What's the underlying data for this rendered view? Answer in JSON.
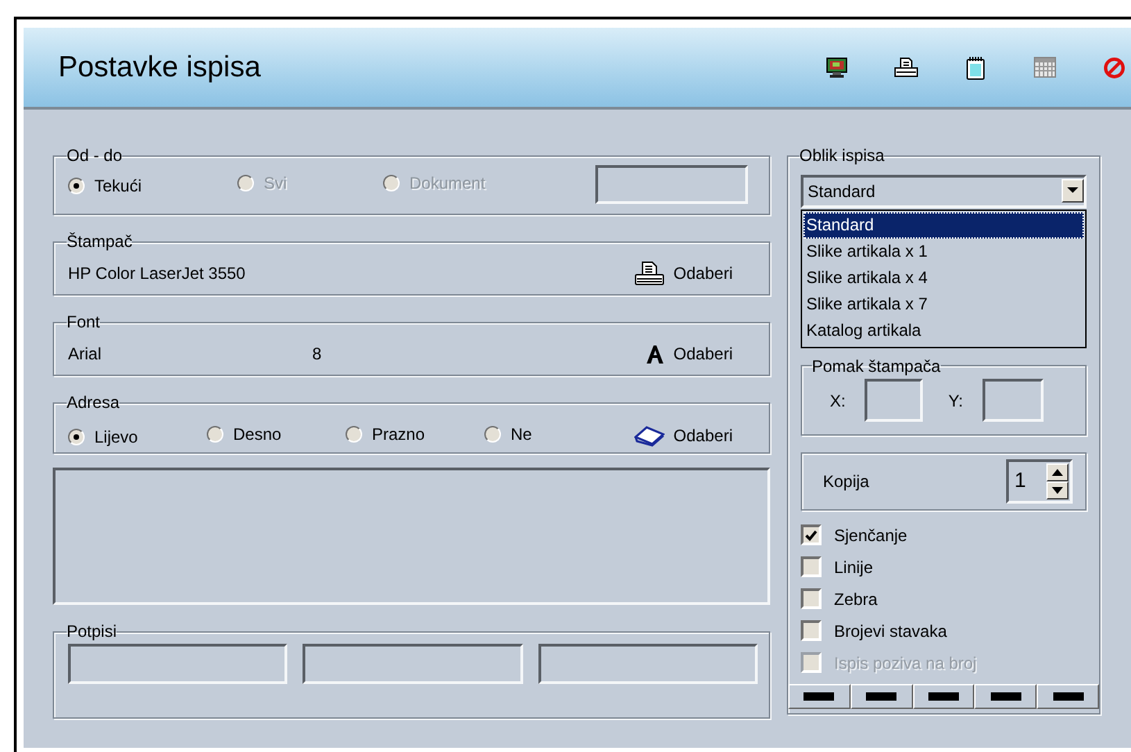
{
  "window": {
    "title": "Postavke ispisa"
  },
  "toolbar": [
    {
      "kind": "monitor"
    },
    {
      "kind": "printer"
    },
    {
      "kind": "notepad"
    },
    {
      "kind": "calendar"
    },
    {
      "kind": "cancel"
    }
  ],
  "range": {
    "legend": "Od - do",
    "options": [
      {
        "label": "Tekući",
        "selected": true,
        "disabled": false
      },
      {
        "label": "Svi",
        "selected": false,
        "disabled": true
      },
      {
        "label": "Dokument",
        "selected": false,
        "disabled": true
      }
    ]
  },
  "printer": {
    "legend": "Štampač",
    "name": "HP Color LaserJet 3550",
    "button": "Odaberi"
  },
  "font": {
    "legend": "Font",
    "name": "Arial",
    "size": "8",
    "button": "Odaberi"
  },
  "address": {
    "legend": "Adresa",
    "options": [
      {
        "label": "Lijevo",
        "selected": true
      },
      {
        "label": "Desno",
        "selected": false
      },
      {
        "label": "Prazno",
        "selected": false
      },
      {
        "label": "Ne",
        "selected": false
      }
    ],
    "button": "Odaberi"
  },
  "signatures": {
    "legend": "Potpisi"
  },
  "layout": {
    "legend": "Oblik ispisa",
    "value": "Standard",
    "options": [
      {
        "label": "Standard",
        "selected": true
      },
      {
        "label": "Slike artikala x 1",
        "selected": false
      },
      {
        "label": "Slike artikala x 4",
        "selected": false
      },
      {
        "label": "Slike artikala x 7",
        "selected": false
      },
      {
        "label": "Katalog artikala",
        "selected": false
      }
    ]
  },
  "offset": {
    "legend": "Pomak štampača",
    "x_label": "X:",
    "y_label": "Y:"
  },
  "copies": {
    "label": "Kopija",
    "value": "1"
  },
  "options": [
    {
      "label": "Sjenčanje",
      "checked": true,
      "disabled": false
    },
    {
      "label": "Linije",
      "checked": false,
      "disabled": false
    },
    {
      "label": "Zebra",
      "checked": false,
      "disabled": false
    },
    {
      "label": "Brojevi stavaka",
      "checked": false,
      "disabled": false
    },
    {
      "label": "Ispis poziva na broj",
      "checked": false,
      "disabled": true
    }
  ]
}
